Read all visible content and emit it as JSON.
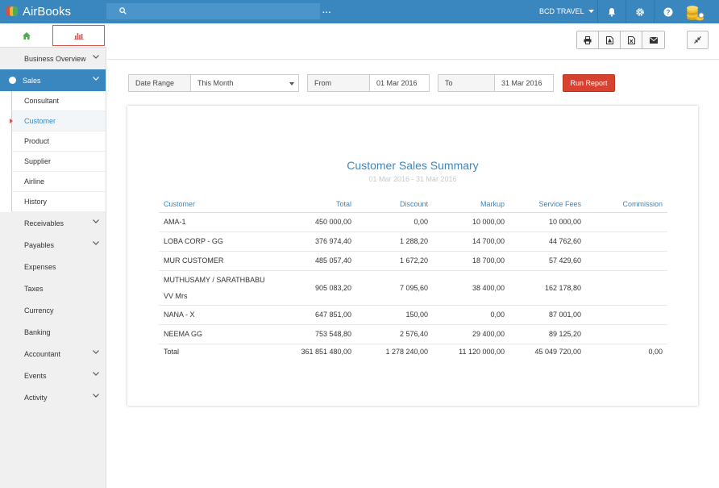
{
  "app": {
    "title": "AirBooks",
    "company": "BCD TRAVEL",
    "search_more": "...",
    "colors": {
      "primary": "#3a87c0",
      "danger": "#d7412f"
    }
  },
  "sidebar": {
    "tabs": [
      {
        "icon": "home-icon"
      },
      {
        "icon": "bar-chart-icon"
      }
    ],
    "items_top": [
      {
        "label": "Business Overview",
        "expandable": true
      }
    ],
    "active": {
      "label": "Sales"
    },
    "sub_items": [
      {
        "label": "Consultant"
      },
      {
        "label": "Customer",
        "current": true
      },
      {
        "label": "Product"
      },
      {
        "label": "Supplier"
      },
      {
        "label": "Airline"
      },
      {
        "label": "History"
      }
    ],
    "items_bottom": [
      {
        "label": "Receivables",
        "expandable": true
      },
      {
        "label": "Payables",
        "expandable": true
      },
      {
        "label": "Expenses",
        "expandable": false
      },
      {
        "label": "Taxes",
        "expandable": false
      },
      {
        "label": "Currency",
        "expandable": false
      },
      {
        "label": "Banking",
        "expandable": false
      },
      {
        "label": "Accountant",
        "expandable": true
      },
      {
        "label": "Events",
        "expandable": true
      },
      {
        "label": "Activity",
        "expandable": true
      }
    ]
  },
  "toolbar": {
    "buttons": [
      "print-icon",
      "pdf-icon",
      "excel-icon",
      "email-icon"
    ],
    "collapse": "compress-icon"
  },
  "filters": {
    "date_range_label": "Date Range",
    "date_range_value": "This Month",
    "from_label": "From",
    "from_value": "01 Mar 2016",
    "to_label": "To",
    "to_value": "31 Mar 2016",
    "run_label": "Run Report"
  },
  "report": {
    "title": "Customer Sales Summary",
    "subtitle": "01 Mar 2016 - 31 Mar 2016",
    "columns": [
      "Customer",
      "Total",
      "Discount",
      "Markup",
      "Service Fees",
      "Commission"
    ],
    "rows": [
      [
        "AMA-1",
        "450 000,00",
        "0,00",
        "10 000,00",
        "10 000,00",
        ""
      ],
      [
        "LOBA CORP - GG",
        "376 974,40",
        "1 288,20",
        "14 700,00",
        "44 762,60",
        ""
      ],
      [
        "MUR CUSTOMER",
        "485 057,40",
        "1 672,20",
        "18 700,00",
        "57 429,60",
        ""
      ],
      [
        "MUTHUSAMY / SARATHBABU VV Mrs",
        "905 083,20",
        "7 095,60",
        "38 400,00",
        "162 178,80",
        ""
      ],
      [
        "NANA - X",
        "647 851,00",
        "150,00",
        "0,00",
        "87 001,00",
        ""
      ],
      [
        "NEEMA GG",
        "753 548,80",
        "2 576,40",
        "29 400,00",
        "89 125,20",
        ""
      ]
    ],
    "total": [
      "Total",
      "361 851 480,00",
      "1 278 240,00",
      "11 120 000,00",
      "45 049 720,00",
      "0,00"
    ]
  }
}
